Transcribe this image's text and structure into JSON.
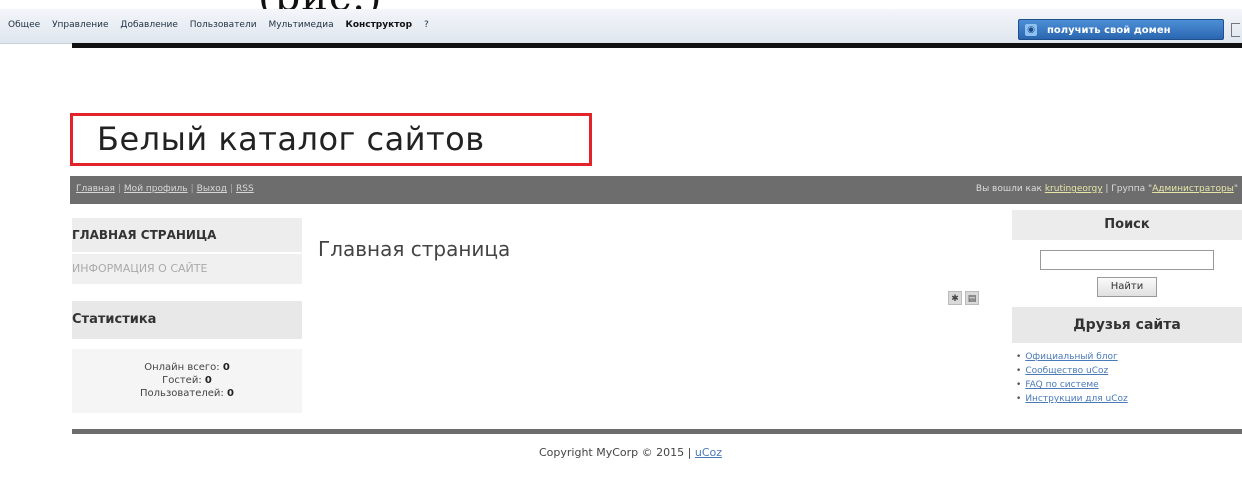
{
  "cut_heading": "(рис.)",
  "adminbar": {
    "items": [
      "Общее",
      "Управление",
      "Добавление",
      "Пользователи",
      "Мультимедиа"
    ],
    "active": "Конструктор",
    "help": "?",
    "domain_button": "получить свой домен"
  },
  "logo": {
    "title": "Белый каталог сайтов"
  },
  "navbar": {
    "links": [
      "Главная",
      "Мой профиль",
      "Выход",
      "RSS"
    ],
    "logged_prefix": "Вы вошли как",
    "username": "krutingeorgy",
    "group_prefix": "| Группа \"",
    "group": "Администраторы",
    "group_suffix": "\""
  },
  "leftcol": {
    "home": "ГЛАВНАЯ СТРАНИЦА",
    "info": "ИНФОРМАЦИЯ О САЙТЕ",
    "stats_title": "Статистика",
    "online_label": "Онлайн всего:",
    "online_value": "0",
    "guests_label": "Гостей:",
    "guests_value": "0",
    "users_label": "Пользователей:",
    "users_value": "0"
  },
  "main": {
    "title": "Главная страница"
  },
  "search": {
    "title": "Поиск",
    "button": "Найти",
    "value": ""
  },
  "friends": {
    "title": "Друзья сайта",
    "links": [
      "Официальный блог",
      "Сообщество uCoz",
      "FAQ по системе",
      "Инструкции для uCoz"
    ]
  },
  "footer": {
    "copyright": "Copyright MyCorp © 2015",
    "sep": "|",
    "link": "uCoz"
  }
}
